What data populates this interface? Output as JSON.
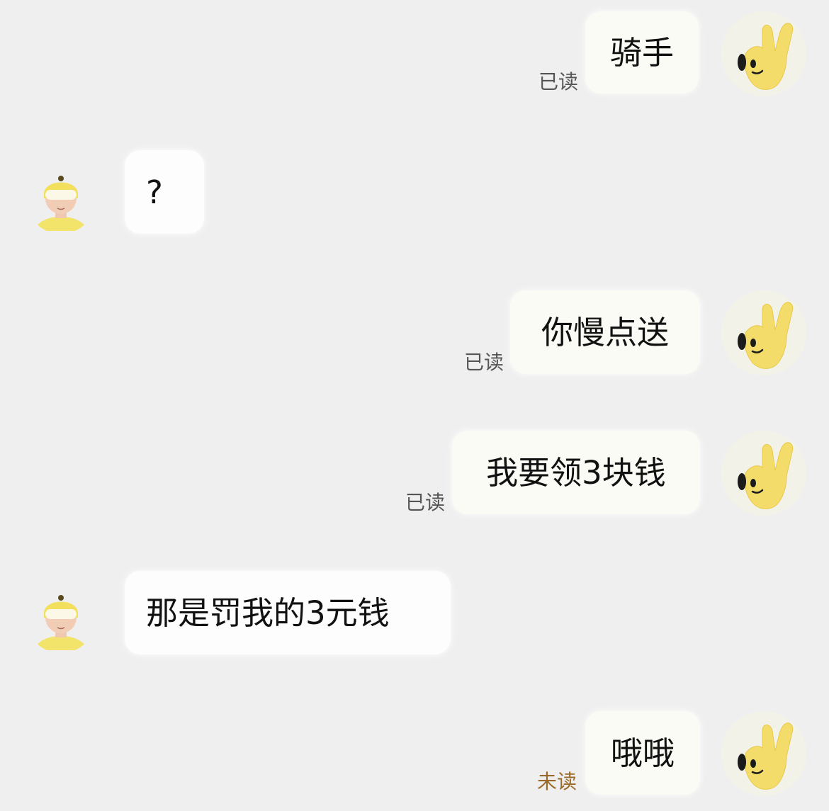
{
  "messages": [
    {
      "side": "out",
      "text": "骑手",
      "status": "已读"
    },
    {
      "side": "in",
      "text": "?"
    },
    {
      "side": "out",
      "text": "你慢点送",
      "status": "已读"
    },
    {
      "side": "out",
      "text": "我要领3块钱",
      "status": "已读"
    },
    {
      "side": "in",
      "text": "那是罚我的3元钱"
    },
    {
      "side": "out",
      "text": "哦哦",
      "status": "未读"
    }
  ],
  "icons": {
    "self_avatar": "yellow-hand-mascot-icon",
    "rider_avatar": "rider-helmet-icon"
  },
  "colors": {
    "background": "#efefef",
    "outgoing_bubble": "#fbfbf5",
    "incoming_bubble": "#fdfdfd",
    "read_status": "#555555",
    "unread_status": "#9a6a2a",
    "mascot_yellow": "#f3dc6a"
  }
}
